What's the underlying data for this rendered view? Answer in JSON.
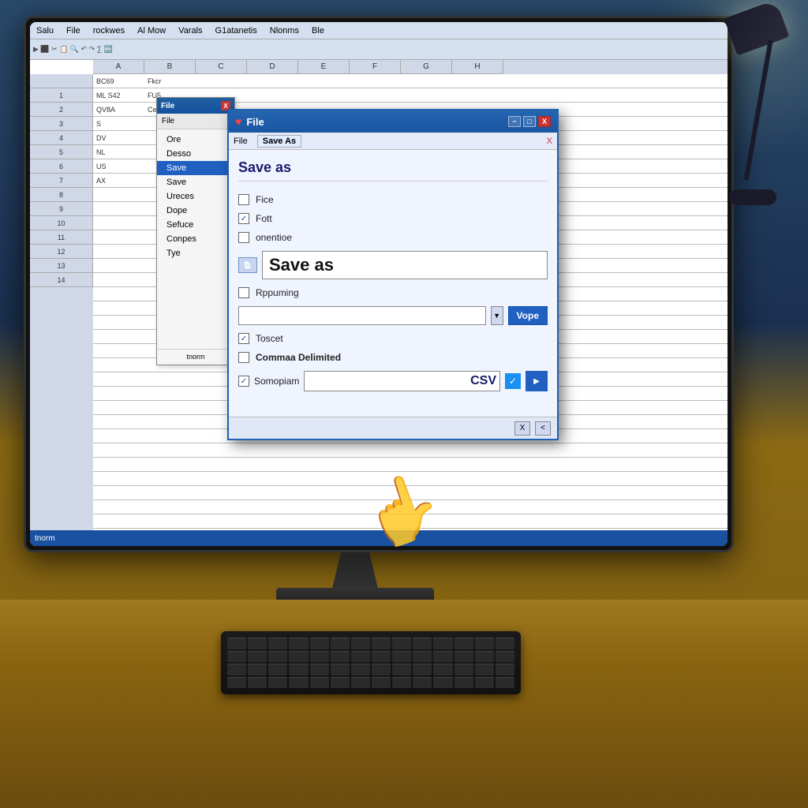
{
  "scene": {
    "background": "desk with monitor"
  },
  "menubar": {
    "items": [
      "Salu",
      "File",
      "rockwes",
      "Al Mow",
      "Varals",
      "G1atanetis",
      "Nlonms",
      "Ble"
    ]
  },
  "bg_file_window": {
    "title": "File",
    "close_label": "X",
    "menu_label": "File",
    "items": [
      {
        "label": "Ore",
        "selected": false
      },
      {
        "label": "Desso",
        "selected": false
      },
      {
        "label": "Save",
        "selected": true
      },
      {
        "label": "Save",
        "selected": false
      },
      {
        "label": "Ureces",
        "selected": false
      },
      {
        "label": "Dope",
        "selected": false
      },
      {
        "label": "Sefuce",
        "selected": false
      },
      {
        "label": "Conpes",
        "selected": false
      },
      {
        "label": "Tye",
        "selected": false
      }
    ],
    "footer": "tnorm"
  },
  "save_as_dialog": {
    "title": "File",
    "heart": "♥",
    "close_btn": "X",
    "min_btn": "−",
    "max_btn": "□",
    "menubar": {
      "file_label": "File",
      "saveas_label": "Save As",
      "close_label": "X"
    },
    "header": "Save as",
    "options": [
      {
        "label": "Fice",
        "checked": false
      },
      {
        "label": "Fott",
        "checked": true
      },
      {
        "label": "onentioe",
        "checked": false
      },
      {
        "label": "Rppuming",
        "checked": false
      },
      {
        "label": "Toscet",
        "checked": true
      },
      {
        "label": "Commaa Delimited",
        "checked": false
      },
      {
        "label": "Somopiam",
        "checked": true
      }
    ],
    "filename": {
      "placeholder": "Save as",
      "value": ""
    },
    "type_placeholder": "",
    "vope_btn": "Vope",
    "csv_value": "CSV",
    "footer": {
      "btn1": "X",
      "btn2": "<"
    }
  },
  "spreadsheet": {
    "columns": [
      "A",
      "B",
      "C",
      "D",
      "E",
      "F",
      "G",
      "H"
    ],
    "rows": [
      [
        "BC69",
        "Fkcr",
        "",
        "",
        "",
        "",
        "",
        ""
      ],
      [
        "ML S42",
        "FU5",
        "",
        "",
        "",
        "",
        "",
        ""
      ],
      [
        "QV8A",
        "Cel",
        "",
        "",
        "",
        "",
        "",
        ""
      ],
      [
        "S",
        "",
        "",
        "",
        "",
        "",
        "",
        ""
      ],
      [
        "DV",
        "",
        "",
        "",
        "",
        "",
        "",
        ""
      ],
      [
        "NL",
        "",
        "",
        "",
        "",
        "",
        "",
        ""
      ],
      [
        "US",
        "",
        "",
        "",
        "",
        "",
        "",
        ""
      ],
      [
        "AX",
        "",
        "",
        "",
        "",
        "",
        "",
        ""
      ]
    ],
    "status": "tnorm"
  }
}
